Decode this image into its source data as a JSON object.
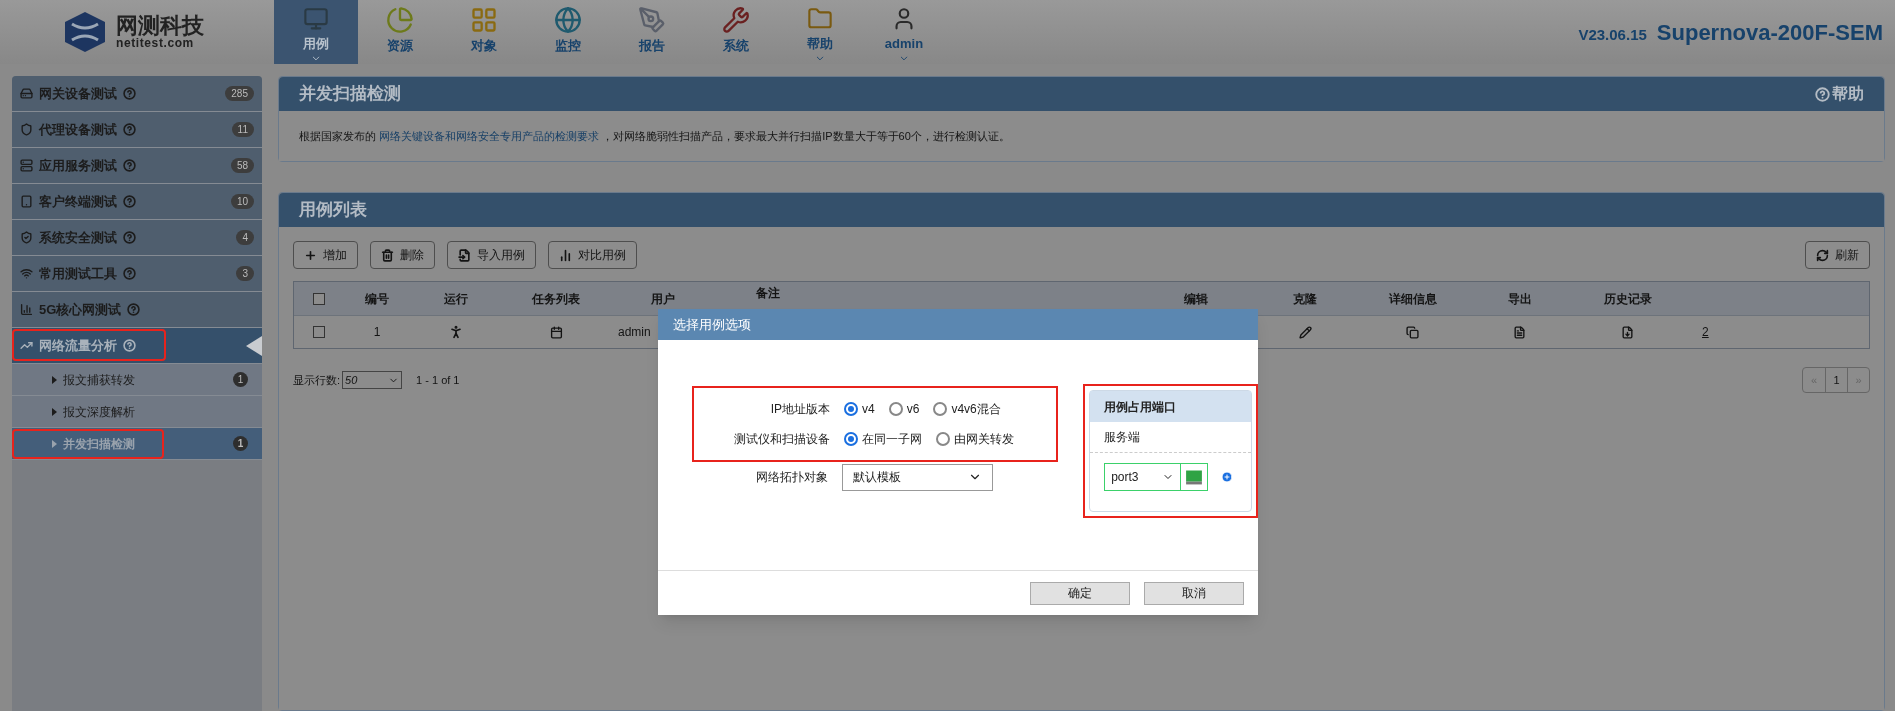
{
  "top_bar": {
    "logo": {
      "name": "网测科技",
      "domain": "netitest.com"
    },
    "nav": [
      {
        "label": "用例",
        "selected": true,
        "dropdown": true
      },
      {
        "label": "资源",
        "selected": false,
        "dropdown": false
      },
      {
        "label": "对象",
        "selected": false,
        "dropdown": false
      },
      {
        "label": "监控",
        "selected": false,
        "dropdown": false
      },
      {
        "label": "报告",
        "selected": false,
        "dropdown": false
      },
      {
        "label": "系统",
        "selected": false,
        "dropdown": false
      },
      {
        "label": "帮助",
        "selected": false,
        "dropdown": true
      },
      {
        "label": "admin",
        "selected": false,
        "dropdown": true
      }
    ],
    "version": "V23.06.15",
    "product": "Supernova-200F-SEM"
  },
  "sidebar": {
    "items": [
      {
        "label": "网关设备测试",
        "count": "285",
        "selected": false,
        "expanded": false
      },
      {
        "label": "代理设备测试",
        "count": "11",
        "selected": false,
        "expanded": false
      },
      {
        "label": "应用服务测试",
        "count": "58",
        "selected": false,
        "expanded": false
      },
      {
        "label": "客户终端测试",
        "count": "10",
        "selected": false,
        "expanded": false
      },
      {
        "label": "系统安全测试",
        "count": "4",
        "selected": false,
        "expanded": false
      },
      {
        "label": "常用测试工具",
        "count": "3",
        "selected": false,
        "expanded": false
      },
      {
        "label": "5G核心网测试",
        "selected": false,
        "expanded": false
      },
      {
        "label": "网络流量分析",
        "selected": true,
        "expanded": true,
        "highlighted": true,
        "children": [
          {
            "label": "报文捕获转发",
            "count": "1",
            "selected": false,
            "highlighted": false
          },
          {
            "label": "报文深度解析",
            "selected": false,
            "highlighted": false
          },
          {
            "label": "并发扫描检测",
            "count": "1",
            "selected": true,
            "highlighted": true
          }
        ]
      }
    ]
  },
  "intro_panel": {
    "title": "并发扫描检测",
    "help": "帮助",
    "description": {
      "before": "根据国家发布的",
      "link": "网络关键设备和网络安全专用产品的检测要求",
      "after": "，对网络脆弱性扫描产品，要求最大并行扫描IP数量大于等于60个，进行检测认证。"
    }
  },
  "case_panel": {
    "title": "用例列表",
    "toolbar": [
      "增加",
      "删除",
      "导入用例",
      "对比用例"
    ],
    "refresh": "刷新",
    "all_checked": false,
    "columns": [
      "编号",
      "运行",
      "任务列表",
      "用户",
      "备注",
      "编辑",
      "克隆",
      "详细信息",
      "导出",
      "历史记录"
    ],
    "rows": [
      {
        "checked": false,
        "number": "1",
        "user": "admin",
        "history": "2"
      }
    ],
    "pagination": {
      "rows_label": "显示行数:",
      "rows_per_page": "50",
      "range": "1 - 1 of 1",
      "pages": [
        {
          "label": "«",
          "disabled": true
        },
        {
          "label": "1",
          "disabled": false
        },
        {
          "label": "»",
          "disabled": true
        }
      ]
    }
  },
  "dialog": {
    "title": "选择用例选项",
    "options": [
      {
        "kind": "radio",
        "label": "IP地址版本",
        "choices": [
          {
            "label": "v4",
            "selected": true
          },
          {
            "label": "v6",
            "selected": false
          },
          {
            "label": "v4v6混合",
            "selected": false
          }
        ]
      },
      {
        "kind": "radio",
        "label": "测试仪和扫描设备",
        "choices": [
          {
            "label": "在同一子网",
            "selected": true
          },
          {
            "label": "由网关转发",
            "selected": false
          }
        ]
      },
      {
        "kind": "select",
        "label": "网络拓扑对象",
        "value": "默认模板"
      }
    ],
    "ports": {
      "title": "用例占用端口",
      "role": "服务端",
      "port": "port3"
    },
    "buttons": [
      "确定",
      "取消"
    ]
  }
}
